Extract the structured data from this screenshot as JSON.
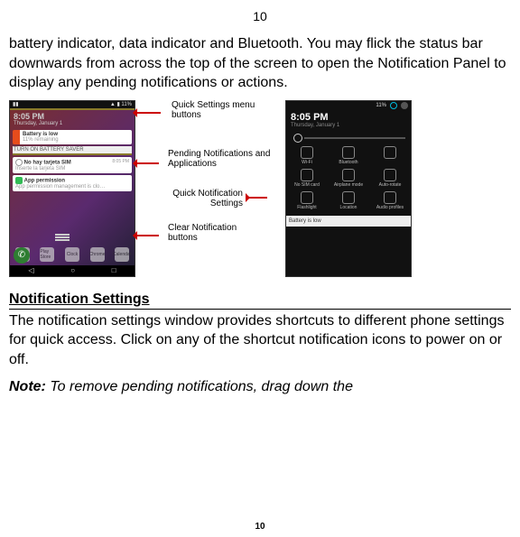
{
  "page": {
    "top_number": "10",
    "bottom_number": "10"
  },
  "intro": "battery indicator, data indicator and Bluetooth. You may flick the status bar downwards from across the top of the screen to open the Notification Panel to display any pending notifications or actions.",
  "section_heading": "Notification Settings",
  "section_body": "The notification settings window provides shortcuts to different phone settings for quick access. Click on any of the shortcut notification icons to power on or off.",
  "note_label": "Note:",
  "note_body": " To remove pending notifications, drag down the",
  "labels": {
    "quick_settings_menu": "Quick Settings menu buttons",
    "pending": "Pending Notifications and Applications",
    "quick_notif_settings": "Quick Notification Settings",
    "clear": "Clear Notification buttons"
  },
  "phone1": {
    "time": "8:05 PM",
    "date": "Thursday, January 1",
    "battery_title": "Battery is low",
    "battery_sub": "11% remaining",
    "saver": "TURN ON BATTERY SAVER",
    "sim_title": "No hay tarjeta SIM",
    "sim_sub": "Inserte la tarjeta SIM",
    "sim_time": "8:05 PM",
    "app_title": "App permission",
    "app_sub": "App permission management is clo…",
    "dock": [
      "Google",
      "Play Store",
      "Clock",
      "Chrome",
      "Calendar"
    ]
  },
  "phone2": {
    "batt_pct": "11%",
    "time": "8:05 PM",
    "date": "Thursday, January 1",
    "tiles": [
      "Wi-Fi",
      "Bluetooth",
      "",
      "No SIM card",
      "Airplane mode",
      "Auto-rotate",
      "Flashlight",
      "Location",
      "Audio profiles"
    ],
    "bottom": "Battery is low"
  }
}
